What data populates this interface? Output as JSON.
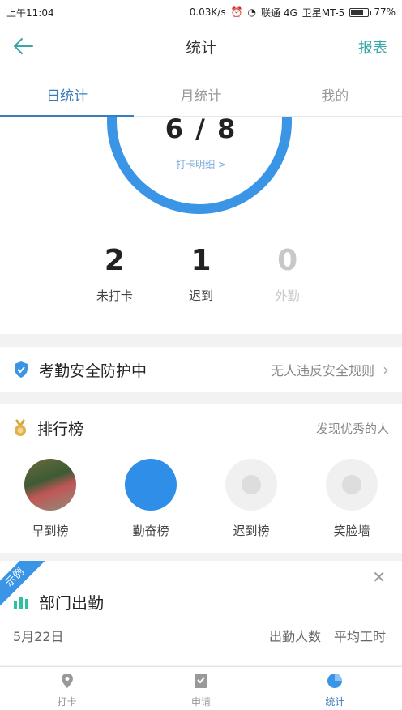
{
  "status_bar": {
    "time": "上午11:04",
    "speed": "0.03K/s",
    "carrier1": "联通 4G",
    "carrier2": "卫星MT-5",
    "battery": "77%",
    "battery_level": 0.77
  },
  "header": {
    "title": "统计",
    "report": "报表",
    "back_icon": "arrow-left-icon"
  },
  "tabs": [
    {
      "label": "日统计",
      "active": true
    },
    {
      "label": "月统计",
      "active": false
    },
    {
      "label": "我的",
      "active": false
    }
  ],
  "summary": {
    "ring_value": "6 / 8",
    "ring_link": "打卡明细 >",
    "ring_color": "#3a95e6",
    "counters": [
      {
        "value": "2",
        "label": "未打卡"
      },
      {
        "value": "1",
        "label": "迟到"
      },
      {
        "value": "0",
        "label": "外勤"
      }
    ]
  },
  "security": {
    "label": "考勤安全防护中",
    "tip": "无人违反安全规则",
    "icon": "shield-icon"
  },
  "ranking": {
    "title": "排行榜",
    "more": "发现优秀的人",
    "icon": "medal-icon",
    "items": [
      {
        "label": "早到榜"
      },
      {
        "label": "勤奋榜"
      },
      {
        "label": "迟到榜"
      },
      {
        "label": "笑脸墙"
      }
    ]
  },
  "department": {
    "ribbon": "示例",
    "title": "部门出勤",
    "date": "5月22日",
    "col1": "出勤人数",
    "col2": "平均工时",
    "icon": "bar-chart-icon"
  },
  "bottom_nav": [
    {
      "label": "打卡",
      "icon": "location-pin-icon"
    },
    {
      "label": "申请",
      "icon": "document-icon"
    },
    {
      "label": "统计",
      "icon": "pie-chart-icon"
    }
  ]
}
